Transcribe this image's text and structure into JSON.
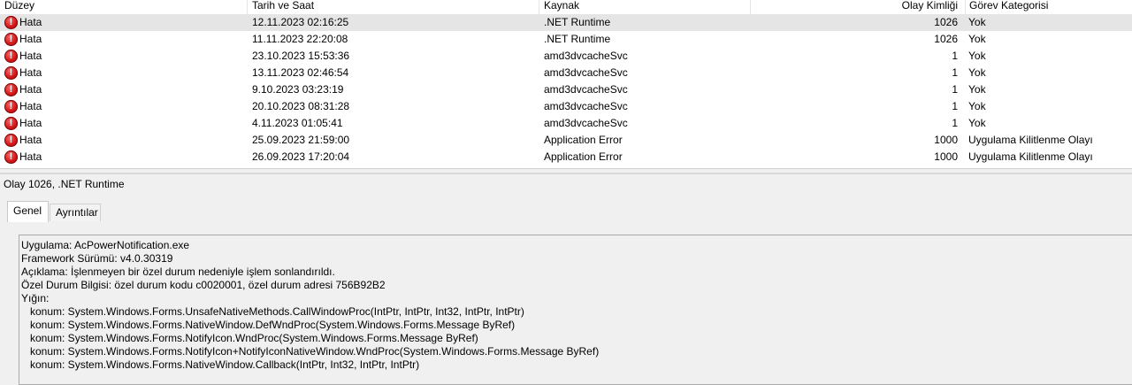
{
  "columns": {
    "level": "Düzey",
    "date": "Tarih ve Saat",
    "source": "Kaynak",
    "event_id": "Olay Kimliği",
    "task": "Görev Kategorisi"
  },
  "rows": [
    {
      "level": "Hata",
      "date": "12.11.2023 02:16:25",
      "source": ".NET Runtime",
      "event_id": "1026",
      "task": "Yok",
      "selected": true
    },
    {
      "level": "Hata",
      "date": "11.11.2023 22:20:08",
      "source": ".NET Runtime",
      "event_id": "1026",
      "task": "Yok"
    },
    {
      "level": "Hata",
      "date": "23.10.2023 15:53:36",
      "source": "amd3dvcacheSvc",
      "event_id": "1",
      "task": "Yok"
    },
    {
      "level": "Hata",
      "date": "13.11.2023 02:46:54",
      "source": "amd3dvcacheSvc",
      "event_id": "1",
      "task": "Yok"
    },
    {
      "level": "Hata",
      "date": "9.10.2023 03:23:19",
      "source": "amd3dvcacheSvc",
      "event_id": "1",
      "task": "Yok"
    },
    {
      "level": "Hata",
      "date": "20.10.2023 08:31:28",
      "source": "amd3dvcacheSvc",
      "event_id": "1",
      "task": "Yok"
    },
    {
      "level": "Hata",
      "date": "4.11.2023 01:05:41",
      "source": "amd3dvcacheSvc",
      "event_id": "1",
      "task": "Yok"
    },
    {
      "level": "Hata",
      "date": "25.09.2023 21:59:00",
      "source": "Application Error",
      "event_id": "1000",
      "task": "Uygulama Kilitlenme Olayı"
    },
    {
      "level": "Hata",
      "date": "26.09.2023 17:20:04",
      "source": "Application Error",
      "event_id": "1000",
      "task": "Uygulama Kilitlenme Olayı"
    }
  ],
  "error_icon": "error-circle-icon",
  "error_icon_color": "#d41515",
  "detail": {
    "title": "Olay 1026, .NET Runtime",
    "tabs": [
      "Genel",
      "Ayrıntılar"
    ],
    "lines": [
      {
        "text": "Uygulama: AcPowerNotification.exe",
        "indent": false
      },
      {
        "text": "Framework Sürümü: v4.0.30319",
        "indent": false
      },
      {
        "text": "Açıklama: İşlenmeyen bir özel durum nedeniyle işlem sonlandırıldı.",
        "indent": false
      },
      {
        "text": "Özel Durum Bilgisi: özel durum kodu c0020001, özel durum adresi 756B92B2",
        "indent": false
      },
      {
        "text": "Yığın:",
        "indent": false
      },
      {
        "text": "konum: System.Windows.Forms.UnsafeNativeMethods.CallWindowProc(IntPtr, IntPtr, Int32, IntPtr, IntPtr)",
        "indent": true
      },
      {
        "text": "konum: System.Windows.Forms.NativeWindow.DefWndProc(System.Windows.Forms.Message ByRef)",
        "indent": true
      },
      {
        "text": "konum: System.Windows.Forms.NotifyIcon.WndProc(System.Windows.Forms.Message ByRef)",
        "indent": true
      },
      {
        "text": "konum: System.Windows.Forms.NotifyIcon+NotifyIconNativeWindow.WndProc(System.Windows.Forms.Message ByRef)",
        "indent": true
      },
      {
        "text": "konum: System.Windows.Forms.NativeWindow.Callback(IntPtr, Int32, IntPtr, IntPtr)",
        "indent": true
      }
    ]
  }
}
